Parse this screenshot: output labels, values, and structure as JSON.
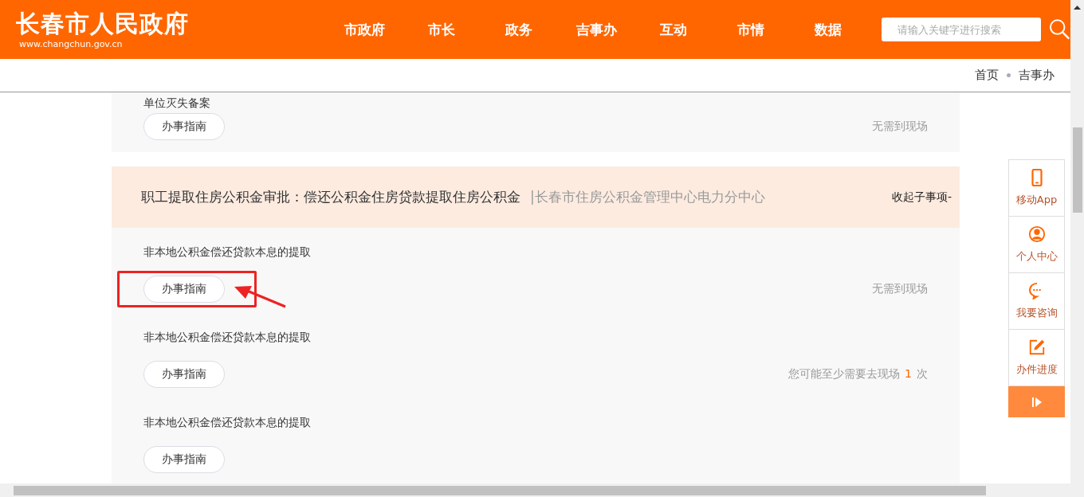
{
  "header": {
    "site_title": "长春市人民政府",
    "site_url": "www.changchun.gov.cn",
    "nav": [
      {
        "label": "市政府"
      },
      {
        "label": "市长"
      },
      {
        "label": "政务"
      },
      {
        "label": "吉事办"
      },
      {
        "label": "互动"
      },
      {
        "label": "市情"
      },
      {
        "label": "数据"
      }
    ],
    "search": {
      "placeholder": "请输入关键字进行搜索"
    }
  },
  "breadcrumb": [
    "首页",
    "吉事办"
  ],
  "groups": [
    {
      "items": [
        {
          "title": "单位灭失备案",
          "button": "办事指南",
          "note": {
            "kind": "plain",
            "text": "无需到现场"
          }
        }
      ]
    },
    {
      "heading": {
        "title": "职工提取住房公积金审批：偿还公积金住房贷款提取住房公积金",
        "department": "|长春市住房公积金管理中心电力分中心",
        "toggle": "收起子事项-"
      },
      "items": [
        {
          "title": "非本地公积金偿还贷款本息的提取",
          "button": "办事指南",
          "highlighted": true,
          "note": {
            "kind": "plain",
            "text": "无需到现场"
          }
        },
        {
          "title": "非本地公积金偿还贷款本息的提取",
          "button": "办事指南",
          "highlighted": false,
          "note": {
            "kind": "count",
            "text": "您可能至少需要去现场",
            "count": "1",
            "unit": "次"
          }
        },
        {
          "title": "非本地公积金偿还贷款本息的提取",
          "button": "办事指南",
          "highlighted": false
        }
      ]
    }
  ],
  "side_toolbar": [
    {
      "kind": "phone",
      "label": "移动App"
    },
    {
      "kind": "user",
      "label": "个人中心"
    },
    {
      "kind": "chat",
      "label": "我要咨询"
    },
    {
      "kind": "edit",
      "label": "办件进度"
    }
  ]
}
